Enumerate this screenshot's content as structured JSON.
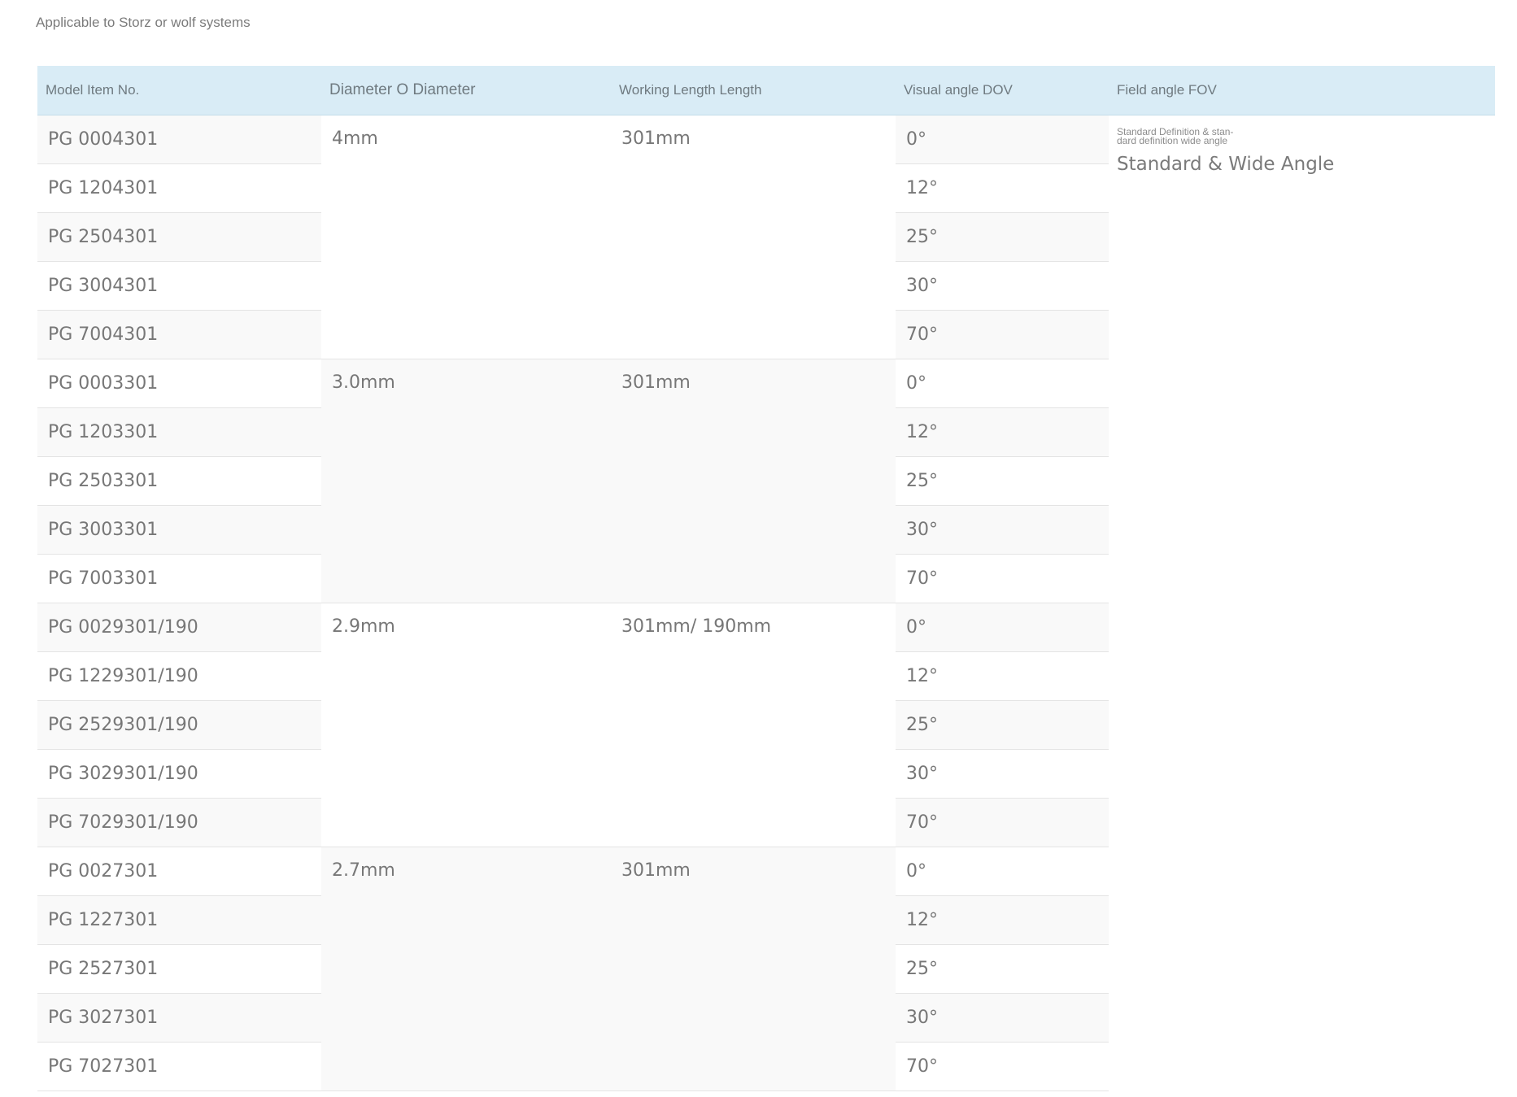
{
  "intro": "Applicable to Storz or wolf systems",
  "headers": {
    "model": "Model Item No.",
    "diameter": "Diameter O Diameter",
    "length": "Working Length Length",
    "dov": "Visual angle DOV",
    "fov": "Field angle FOV"
  },
  "fov": {
    "small": "Standard Definition & stan-dard definition wide angle",
    "large": "Standard & Wide Angle"
  },
  "groups": [
    {
      "diameter": "4mm",
      "length": "301mm",
      "rows": [
        {
          "model": "PG 0004301",
          "dov": "0°"
        },
        {
          "model": "PG 1204301",
          "dov": "12°"
        },
        {
          "model": "PG 2504301",
          "dov": "25°"
        },
        {
          "model": "PG 3004301",
          "dov": "30°"
        },
        {
          "model": "PG 7004301",
          "dov": "70°"
        }
      ]
    },
    {
      "diameter": "3.0mm",
      "length": "301mm",
      "rows": [
        {
          "model": "PG 0003301",
          "dov": "0°"
        },
        {
          "model": "PG 1203301",
          "dov": "12°"
        },
        {
          "model": "PG 2503301",
          "dov": "25°"
        },
        {
          "model": "PG 3003301",
          "dov": "30°"
        },
        {
          "model": "PG 7003301",
          "dov": "70°"
        }
      ]
    },
    {
      "diameter": "2.9mm",
      "length": "301mm/ 190mm",
      "rows": [
        {
          "model": "PG 0029301/190",
          "dov": "0°"
        },
        {
          "model": "PG 1229301/190",
          "dov": "12°"
        },
        {
          "model": "PG 2529301/190",
          "dov": "25°"
        },
        {
          "model": "PG 3029301/190",
          "dov": "30°"
        },
        {
          "model": "PG 7029301/190",
          "dov": "70°"
        }
      ]
    },
    {
      "diameter": "2.7mm",
      "length": "301mm",
      "rows": [
        {
          "model": "PG 0027301",
          "dov": "0°"
        },
        {
          "model": "PG 1227301",
          "dov": "12°"
        },
        {
          "model": "PG 2527301",
          "dov": "25°"
        },
        {
          "model": "PG 3027301",
          "dov": "30°"
        },
        {
          "model": "PG 7027301",
          "dov": "70°"
        }
      ]
    }
  ]
}
